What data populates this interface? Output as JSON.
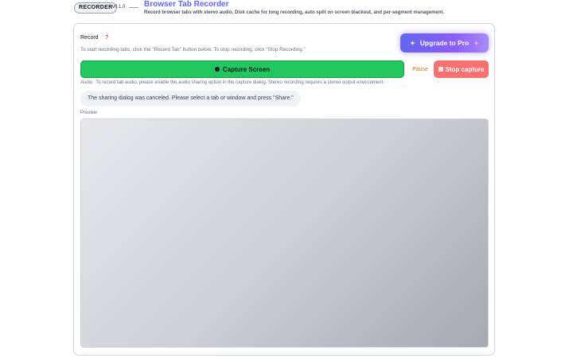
{
  "header": {
    "badge": "RECORDER",
    "version": "v0.1.0",
    "title": "Browser Tab Recorder",
    "description": "Record browser tabs with stereo audio. Disk cache for long recording, auto split on screen blackout, and per-segment management."
  },
  "record": {
    "label": "Record",
    "help_icon": "?",
    "instructions": "To start recording tabs, click the \"Record Tab\" button below. To stop recording, click \"Stop Recording.\""
  },
  "upgrade": {
    "label": "Upgrade to Pro"
  },
  "controls": {
    "capture_label": "Capture Screen",
    "pause_label": "Pause",
    "stop_label": "Stop capture"
  },
  "audio": {
    "label": "Audio",
    "text": "To record tab audio, please enable the audio sharing option in the capture dialog. Stereo recording requires a stereo output environment."
  },
  "notice": "The sharing dialog was canceled. Please select a tab or window and press \"Share.\"",
  "preview": {
    "label": "Preview"
  },
  "colors": {
    "accent": "#6366f1",
    "capture": "#22c55e",
    "stop": "#f87171",
    "pause": "#d97706"
  }
}
